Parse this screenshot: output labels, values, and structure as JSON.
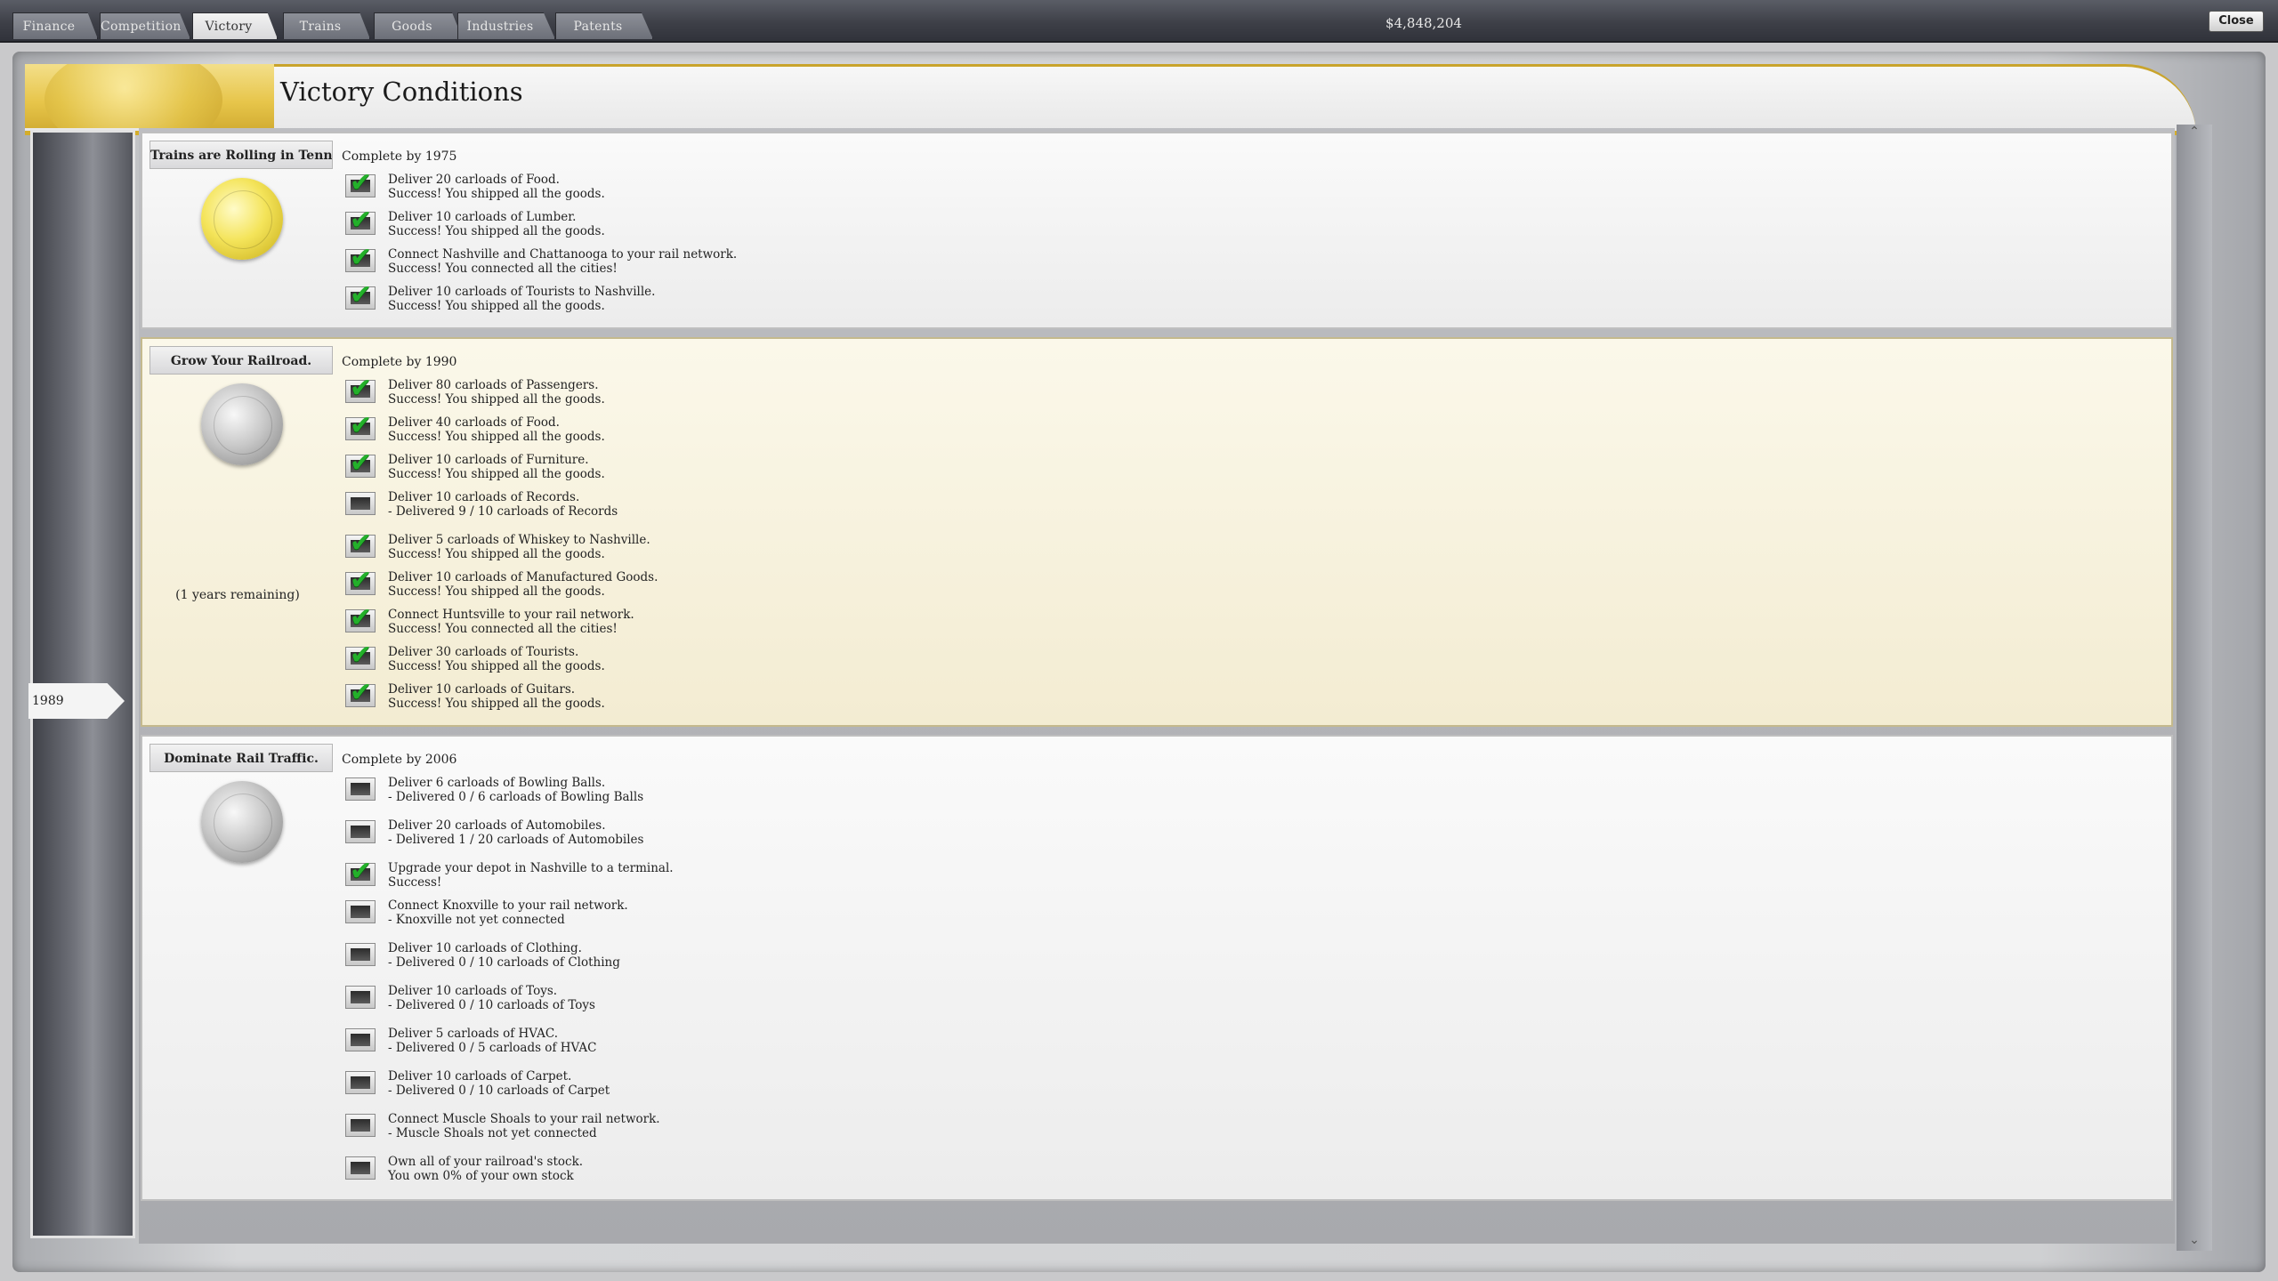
{
  "tabs": [
    "Finance",
    "Competition",
    "Victory",
    "Trains",
    "Goods",
    "Industries",
    "Patents"
  ],
  "active_tab": "Victory",
  "money": "$4,848,204",
  "close_label": "Close",
  "page_title": "Victory Conditions",
  "timeline": {
    "current_year": "1989"
  },
  "sections": [
    {
      "title": "Trains are Rolling in Tennessee.",
      "deadline": "Complete by 1975",
      "medal": "gold",
      "conditions": [
        {
          "done": true,
          "line1": "Deliver 20 carloads of Food.",
          "line2": "Success! You shipped all the goods."
        },
        {
          "done": true,
          "line1": "Deliver 10 carloads of Lumber.",
          "line2": "Success! You shipped all the goods."
        },
        {
          "done": true,
          "line1": "Connect Nashville and Chattanooga to your rail network.",
          "line2": "Success! You connected all the cities!"
        },
        {
          "done": true,
          "line1": "Deliver 10 carloads of Tourists to Nashville.",
          "line2": "Success! You shipped all the goods."
        }
      ]
    },
    {
      "title": "Grow Your Railroad.",
      "deadline": "Complete by 1990",
      "medal": "silver",
      "remaining": "(1 years remaining)",
      "conditions": [
        {
          "done": true,
          "line1": "Deliver 80 carloads of Passengers.",
          "line2": "Success! You shipped all the goods."
        },
        {
          "done": true,
          "line1": "Deliver 40 carloads of Food.",
          "line2": "Success! You shipped all the goods."
        },
        {
          "done": true,
          "line1": "Deliver 10 carloads of Furniture.",
          "line2": "Success! You shipped all the goods."
        },
        {
          "done": false,
          "line1": "Deliver 10 carloads of Records.",
          "line2": "- Delivered 9 / 10 carloads of Records"
        },
        {
          "done": true,
          "line1": "Deliver 5 carloads of Whiskey to Nashville.",
          "line2": "Success! You shipped all the goods."
        },
        {
          "done": true,
          "line1": "Deliver 10 carloads of Manufactured Goods.",
          "line2": "Success! You shipped all the goods."
        },
        {
          "done": true,
          "line1": "Connect Huntsville to your rail network.",
          "line2": "Success! You connected all the cities!"
        },
        {
          "done": true,
          "line1": "Deliver 30 carloads of Tourists.",
          "line2": "Success! You shipped all the goods."
        },
        {
          "done": true,
          "line1": "Deliver 10 carloads of Guitars.",
          "line2": "Success! You shipped all the goods."
        }
      ]
    },
    {
      "title": "Dominate Rail Traffic.",
      "deadline": "Complete by 2006",
      "medal": "silver",
      "conditions": [
        {
          "done": false,
          "line1": "Deliver 6 carloads of Bowling Balls.",
          "line2": "- Delivered 0 / 6 carloads of Bowling Balls"
        },
        {
          "done": false,
          "line1": "Deliver 20 carloads of Automobiles.",
          "line2": "- Delivered 1 / 20 carloads of Automobiles"
        },
        {
          "done": true,
          "line1": "Upgrade your depot in Nashville to a terminal.",
          "line2": "Success!"
        },
        {
          "done": false,
          "line1": "Connect Knoxville to your rail network.",
          "line2": "- Knoxville not yet connected"
        },
        {
          "done": false,
          "line1": "Deliver 10 carloads of Clothing.",
          "line2": "- Delivered 0 / 10 carloads of Clothing"
        },
        {
          "done": false,
          "line1": "Deliver 10 carloads of Toys.",
          "line2": "- Delivered 0 / 10 carloads of Toys"
        },
        {
          "done": false,
          "line1": "Deliver 5 carloads of HVAC.",
          "line2": "- Delivered 0 / 5 carloads of HVAC"
        },
        {
          "done": false,
          "line1": "Deliver 10 carloads of Carpet.",
          "line2": "- Delivered 0 / 10 carloads of Carpet"
        },
        {
          "done": false,
          "line1": "Connect Muscle Shoals to your rail network.",
          "line2": "- Muscle Shoals not yet connected"
        },
        {
          "done": false,
          "line1": "Own all of your railroad's stock.",
          "line2": "You own 0% of your own stock"
        }
      ]
    }
  ],
  "icons": {
    "check": "checkmark-icon",
    "empty": "empty-checkbox-icon",
    "scroll_up": "scroll-up-arrow-icon",
    "scroll_down": "scroll-down-arrow-icon"
  }
}
